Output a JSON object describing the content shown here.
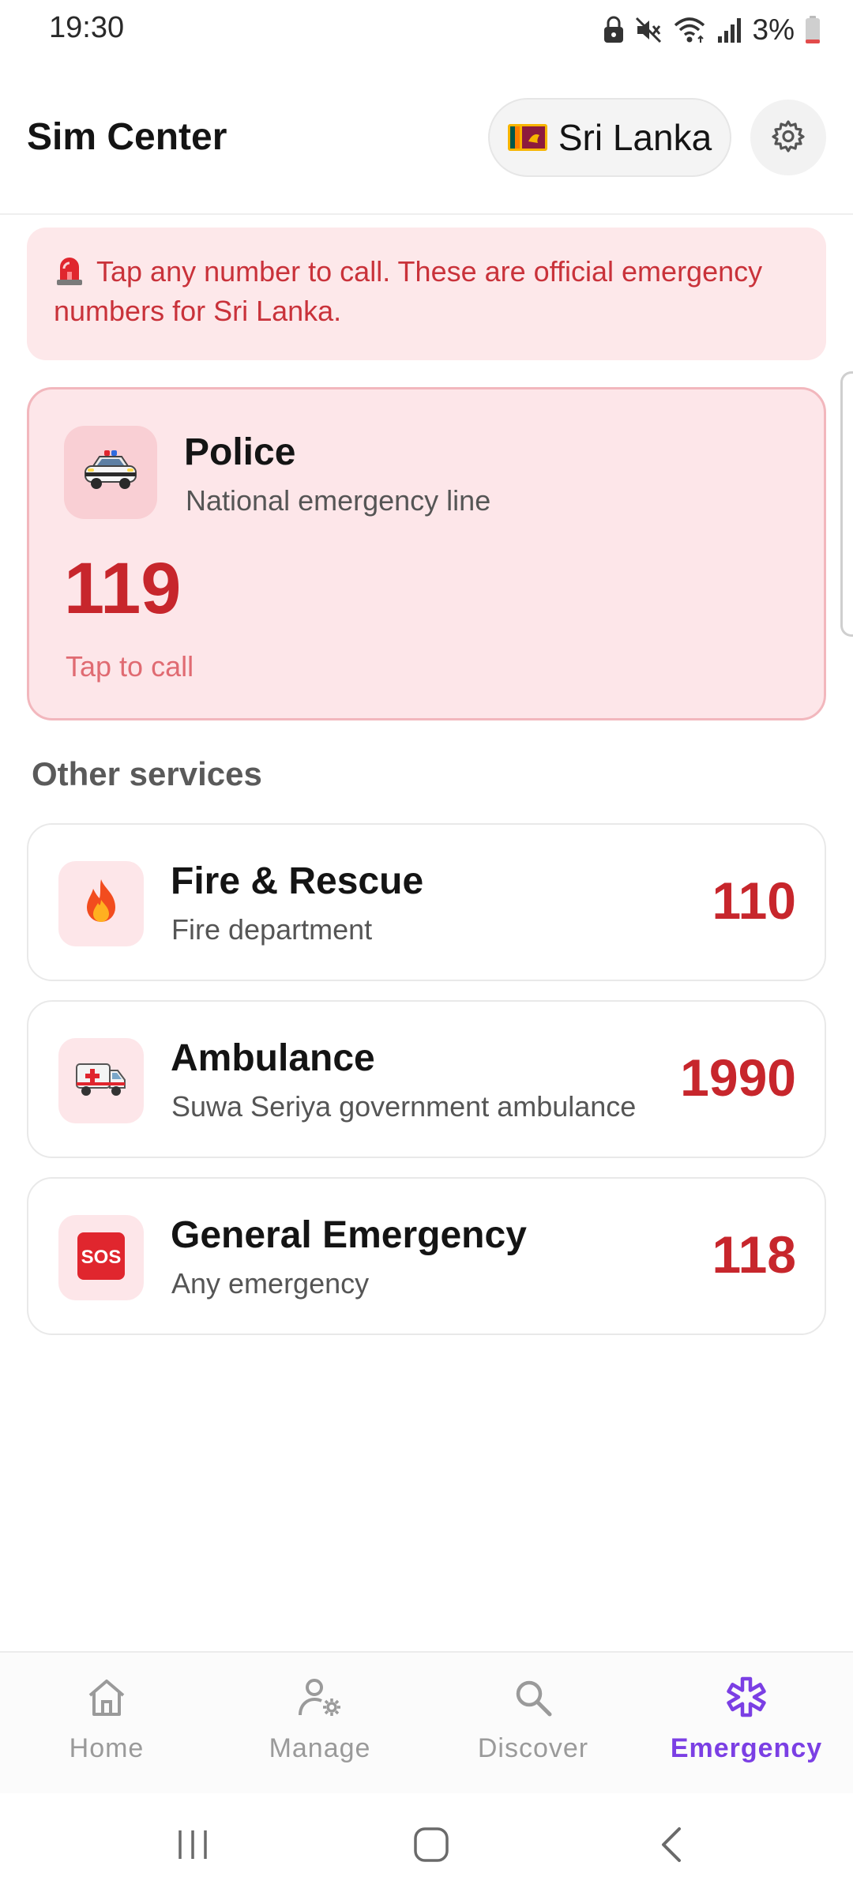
{
  "status_bar": {
    "time": "19:30",
    "battery": "3%",
    "icons": [
      "lock-icon",
      "mute-icon",
      "wifi-icon",
      "signal-icon",
      "battery-icon"
    ]
  },
  "header": {
    "title": "Sim Center",
    "country": "Sri Lanka",
    "flag_icon": "sri-lanka-flag",
    "settings_icon": "gear-icon"
  },
  "banner": {
    "icon": "siren-icon",
    "text": "Tap any number to call. These are official emergency numbers for Sri Lanka."
  },
  "featured": {
    "icon": "police-car-icon",
    "title": "Police",
    "subtitle": "National emergency line",
    "number": "119",
    "action": "Tap to call"
  },
  "section_title": "Other services",
  "services": [
    {
      "icon": "fire-icon",
      "name": "Fire & Rescue",
      "description": "Fire department",
      "number": "110"
    },
    {
      "icon": "ambulance-icon",
      "name": "Ambulance",
      "description": "Suwa Seriya government ambulance",
      "number": "1990"
    },
    {
      "icon": "sos-icon",
      "name": "General Emergency",
      "description": "Any emergency",
      "number": "118"
    }
  ],
  "bottom_nav": {
    "active": "Emergency",
    "items": [
      {
        "label": "Home",
        "icon": "home-icon"
      },
      {
        "label": "Manage",
        "icon": "manage-user-icon"
      },
      {
        "label": "Discover",
        "icon": "search-icon"
      },
      {
        "label": "Emergency",
        "icon": "medical-star-icon"
      }
    ]
  },
  "system_nav": [
    "recents-button",
    "home-button",
    "back-button"
  ],
  "colors": {
    "accent_red": "#c7262c",
    "banner_bg": "#fde8ea",
    "active_nav": "#7b3fe4"
  }
}
